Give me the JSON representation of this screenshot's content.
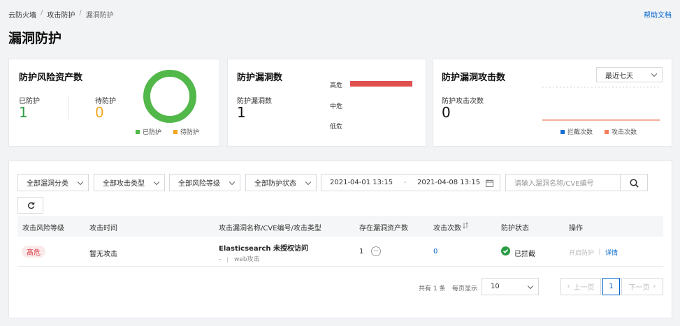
{
  "breadcrumb": {
    "items": [
      "云防火墙",
      "攻击防护",
      "漏洞防护"
    ],
    "separator": "/"
  },
  "help_link": "帮助文档",
  "page_title": "漏洞防护",
  "cards": {
    "assets": {
      "title": "防护风险资产数",
      "protected_label": "已防护",
      "protected_value": "1",
      "pending_label": "待防护",
      "pending_value": "0",
      "legend_protected": "已防护",
      "legend_pending": "待防护",
      "protected_share": 1.0
    },
    "vulns": {
      "title": "防护漏洞数",
      "count_label": "防护漏洞数",
      "count_value": "1",
      "high": "高危",
      "mid": "中危",
      "low": "低危",
      "high_fill": 1.0
    },
    "attacks": {
      "title": "防护漏洞攻击数",
      "range_select": "最近七天",
      "count_label": "防护攻击次数",
      "count_value": "0",
      "legend_blocked": "拦截次数",
      "legend_attacks": "攻击次数"
    }
  },
  "filters": {
    "category": "全部漏洞分类",
    "attack_type": "全部攻击类型",
    "risk_level": "全部风险等级",
    "protect_status": "全部防护状态",
    "date_start": "2021-04-01 13:15",
    "date_sep": "-",
    "date_end": "2021-04-08 13:15",
    "search_placeholder": "请输入漏洞名称/CVE编号"
  },
  "table": {
    "headers": [
      "攻击风险等级",
      "攻击时间",
      "攻击漏洞名称/CVE编号/攻击类型",
      "存在漏洞资产数",
      "攻击次数",
      "防护状态",
      "操作"
    ],
    "row": {
      "risk": "高危",
      "time": "暂无攻击",
      "name": "Elasticsearch 未授权访问",
      "cve": "-",
      "type": "web攻击",
      "assets": "1",
      "attacks": "0",
      "status": "已拦截",
      "action_enable": "开启防护",
      "action_detail": "详情"
    }
  },
  "pagination": {
    "total": "共有 1 条",
    "per_page_label": "每页显示",
    "per_page": "10",
    "prev": "上一页",
    "current": "1",
    "next": "下一页"
  },
  "colors": {
    "green": "#52b84a",
    "orange": "#f5a623",
    "red": "#e0504f",
    "blue": "#1a6fce",
    "coral": "#f07c5e",
    "link": "#0066cc"
  }
}
